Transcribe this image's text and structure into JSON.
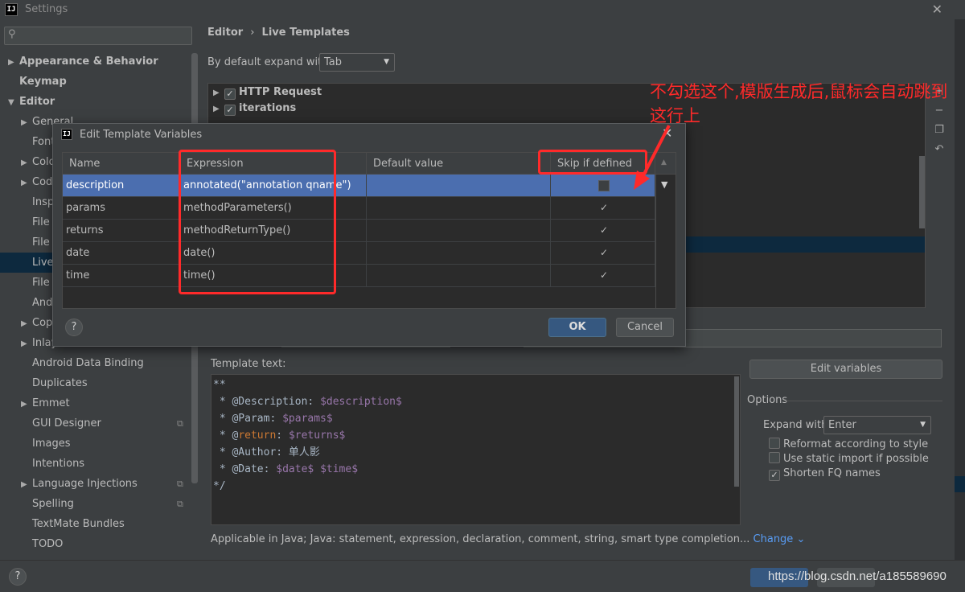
{
  "window": {
    "title": "Settings",
    "app_icon": "IJ"
  },
  "search": {
    "placeholder": "",
    "icon": "search-icon"
  },
  "sidebar": {
    "items": [
      {
        "label": "Appearance & Behavior",
        "level": 0,
        "expandable": true,
        "bold": true
      },
      {
        "label": "Keymap",
        "level": 0,
        "expandable": false,
        "bold": true
      },
      {
        "label": "Editor",
        "level": 0,
        "expandable": true,
        "expanded": true,
        "bold": true
      },
      {
        "label": "General",
        "level": 1,
        "expandable": true
      },
      {
        "label": "Font",
        "level": 1,
        "expandable": false
      },
      {
        "label": "Color Scheme",
        "level": 1,
        "expandable": true
      },
      {
        "label": "Code Style",
        "level": 1,
        "expandable": true
      },
      {
        "label": "Inspections",
        "level": 1,
        "expandable": false
      },
      {
        "label": "File and Code Templates",
        "level": 1,
        "expandable": false
      },
      {
        "label": "File Encodings",
        "level": 1,
        "expandable": false
      },
      {
        "label": "Live Templates",
        "level": 1,
        "expandable": false,
        "selected": true
      },
      {
        "label": "File Types",
        "level": 1,
        "expandable": false
      },
      {
        "label": "Android Layout Editor",
        "level": 1,
        "expandable": false
      },
      {
        "label": "Copyright",
        "level": 1,
        "expandable": true
      },
      {
        "label": "Inlay Hints",
        "level": 1,
        "expandable": true
      },
      {
        "label": "Android Data Binding",
        "level": 1,
        "expandable": false
      },
      {
        "label": "Duplicates",
        "level": 1,
        "expandable": false
      },
      {
        "label": "Emmet",
        "level": 1,
        "expandable": true
      },
      {
        "label": "GUI Designer",
        "level": 1,
        "expandable": false,
        "copy_icon": true
      },
      {
        "label": "Images",
        "level": 1,
        "expandable": false
      },
      {
        "label": "Intentions",
        "level": 1,
        "expandable": false
      },
      {
        "label": "Language Injections",
        "level": 1,
        "expandable": true,
        "copy_icon": true
      },
      {
        "label": "Spelling",
        "level": 1,
        "expandable": false,
        "copy_icon": true
      },
      {
        "label": "TextMate Bundles",
        "level": 1,
        "expandable": false
      },
      {
        "label": "TODO",
        "level": 1,
        "expandable": false
      }
    ]
  },
  "breadcrumb": {
    "parent": "Editor",
    "separator": "›",
    "current": "Live Templates"
  },
  "expand": {
    "label": "By default expand with",
    "value": "Tab"
  },
  "template_groups": [
    {
      "label": "HTTP Request",
      "checked": true
    },
    {
      "label": "iterations",
      "checked": true
    }
  ],
  "template_text": {
    "label": "Template text:",
    "lines": [
      "**",
      " * @Description: $description$",
      " * @Param: $params$",
      " * @return: $returns$",
      " * @Author: 单人影",
      " * @Date: $date$ $time$",
      "*/"
    ]
  },
  "edit_variables_label": "Edit variables",
  "options": {
    "label": "Options",
    "expand_label": "Expand with",
    "expand_value": "Enter",
    "checkboxes": [
      {
        "label": "Reformat according to style",
        "checked": false
      },
      {
        "label": "Use static import if possible",
        "checked": false
      },
      {
        "label": "Shorten FQ names",
        "checked": true
      }
    ]
  },
  "applicable": {
    "text": "Applicable in Java; Java: statement, expression, declaration, comment, string, smart type completion...",
    "link": "Change"
  },
  "dialog": {
    "title": "Edit Template Variables",
    "columns": [
      "Name",
      "Expression",
      "Default value",
      "Skip if defined"
    ],
    "rows": [
      {
        "name": "description",
        "expression": "annotated(\"annotation qname\")",
        "default": "",
        "skip": false,
        "selected": true
      },
      {
        "name": "params",
        "expression": "methodParameters()",
        "default": "",
        "skip": true
      },
      {
        "name": "returns",
        "expression": "methodReturnType()",
        "default": "",
        "skip": true
      },
      {
        "name": "date",
        "expression": "date()",
        "default": "",
        "skip": true
      },
      {
        "name": "time",
        "expression": "time()",
        "default": "",
        "skip": true
      }
    ],
    "ok_label": "OK",
    "cancel_label": "Cancel",
    "help_label": "?"
  },
  "annotation": {
    "text": "不勾选这个,模版生成后,鼠标会自动跳到这行上",
    "color": "#ff2a2a"
  },
  "footer": {
    "help_label": "?",
    "watermark": "https://blog.csdn.net/a185589690"
  },
  "colors": {
    "accent": "#365880",
    "selection": "#4b6eaf",
    "annotation": "#ff2a2a",
    "link": "#589df6"
  }
}
